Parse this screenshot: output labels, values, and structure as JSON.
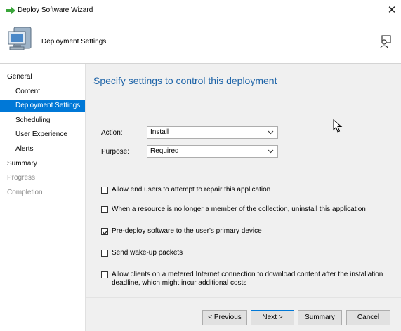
{
  "window": {
    "title": "Deploy Software Wizard",
    "close_glyph": "✕",
    "header_title": "Deployment Settings"
  },
  "sidebar": {
    "items": [
      {
        "label": "General",
        "state": "normal"
      },
      {
        "label": "Content",
        "state": "normal"
      },
      {
        "label": "Deployment Settings",
        "state": "selected"
      },
      {
        "label": "Scheduling",
        "state": "normal"
      },
      {
        "label": "User Experience",
        "state": "normal"
      },
      {
        "label": "Alerts",
        "state": "normal"
      },
      {
        "label": "Summary",
        "state": "normal"
      },
      {
        "label": "Progress",
        "state": "disabled"
      },
      {
        "label": "Completion",
        "state": "disabled"
      }
    ]
  },
  "main": {
    "heading": "Specify settings to control this deployment",
    "action": {
      "label": "Action:",
      "value": "Install"
    },
    "purpose": {
      "label": "Purpose:",
      "value": "Required"
    },
    "checkboxes": [
      {
        "label": "Allow end users to attempt to repair this application",
        "checked": false
      },
      {
        "label": "When a resource is no longer a member of the collection, uninstall this application",
        "checked": false
      },
      {
        "label": "Pre-deploy software to the user's primary device",
        "checked": true
      },
      {
        "label": "Send wake-up packets",
        "checked": false
      },
      {
        "label": "Allow clients on a metered Internet connection to download content after the installation deadline, which might incur additional costs",
        "checked": false
      }
    ]
  },
  "footer": {
    "previous": "< Previous",
    "next": "Next >",
    "summary": "Summary",
    "cancel": "Cancel"
  },
  "colors": {
    "accent": "#0078d7",
    "heading": "#1e64a8",
    "content_bg": "#f0f0f0",
    "disabled_text": "#8a8a8a"
  }
}
